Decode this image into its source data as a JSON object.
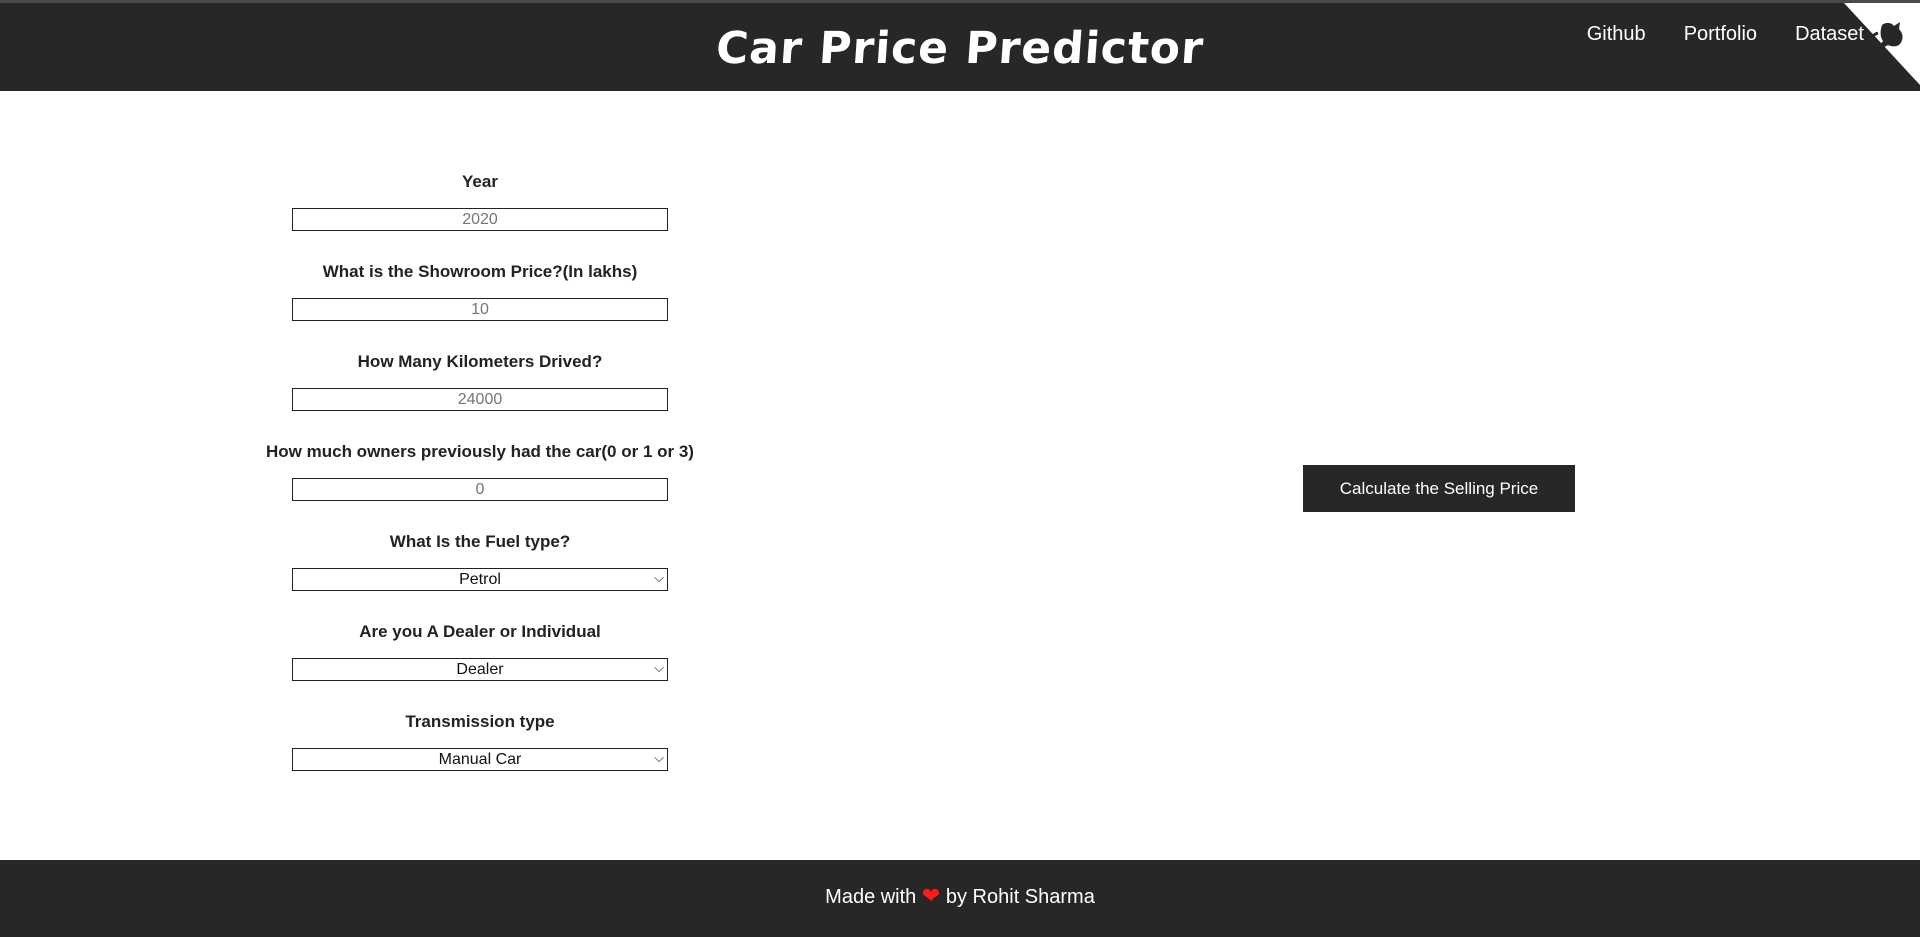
{
  "header": {
    "title": "Car Price Predictor",
    "nav": [
      "Github",
      "Portfolio",
      "Dataset"
    ],
    "corner_icon": "github-corner-icon"
  },
  "form": {
    "year": {
      "label": "Year",
      "placeholder": "2020"
    },
    "showroom_price": {
      "label": "What is the Showroom Price?(In lakhs)",
      "placeholder": "10"
    },
    "kms": {
      "label": "How Many Kilometers Drived?",
      "placeholder": "24000"
    },
    "owners": {
      "label": "How much owners previously had the car(0 or 1 or 3)",
      "placeholder": "0"
    },
    "fuel": {
      "label": "What Is the Fuel type?",
      "selected": "Petrol"
    },
    "seller": {
      "label": "Are you A Dealer or Individual",
      "selected": "Dealer"
    },
    "transmission": {
      "label": "Transmission type",
      "selected": "Manual Car"
    }
  },
  "button": {
    "label": "Calculate the Selling Price"
  },
  "footer": {
    "prefix": "Made with",
    "heart_icon": "heart-icon",
    "suffix": "by Rohit Sharma"
  },
  "colors": {
    "dark": "#272727",
    "heart": "#ff1a1a",
    "white": "#ffffff"
  }
}
